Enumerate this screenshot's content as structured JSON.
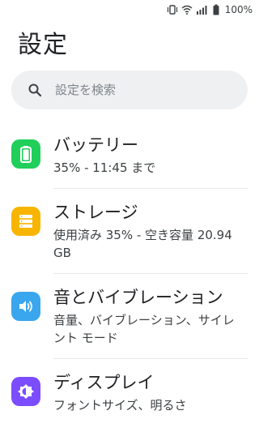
{
  "status_bar": {
    "battery_percent": "100%",
    "icons": [
      "vibrate-icon",
      "wifi-icon",
      "signal-icon",
      "battery-icon"
    ]
  },
  "page": {
    "title": "設定"
  },
  "search": {
    "placeholder": "設定を検索"
  },
  "colors": {
    "battery": "#1fcf5a",
    "storage": "#f7b500",
    "sound": "#3aa6ee",
    "display": "#7c4dff"
  },
  "items": [
    {
      "icon": "battery-icon",
      "title": "バッテリー",
      "summary": "35% - 11:45 まで"
    },
    {
      "icon": "storage-icon",
      "title": "ストレージ",
      "summary": "使用済み 35% - 空き容量 20.94 GB"
    },
    {
      "icon": "volume-icon",
      "title": "音とバイブレーション",
      "summary": "音量、バイブレーション、サイレント モード"
    },
    {
      "icon": "brightness-icon",
      "title": "ディスプレイ",
      "summary": "フォントサイズ、明るさ"
    }
  ]
}
